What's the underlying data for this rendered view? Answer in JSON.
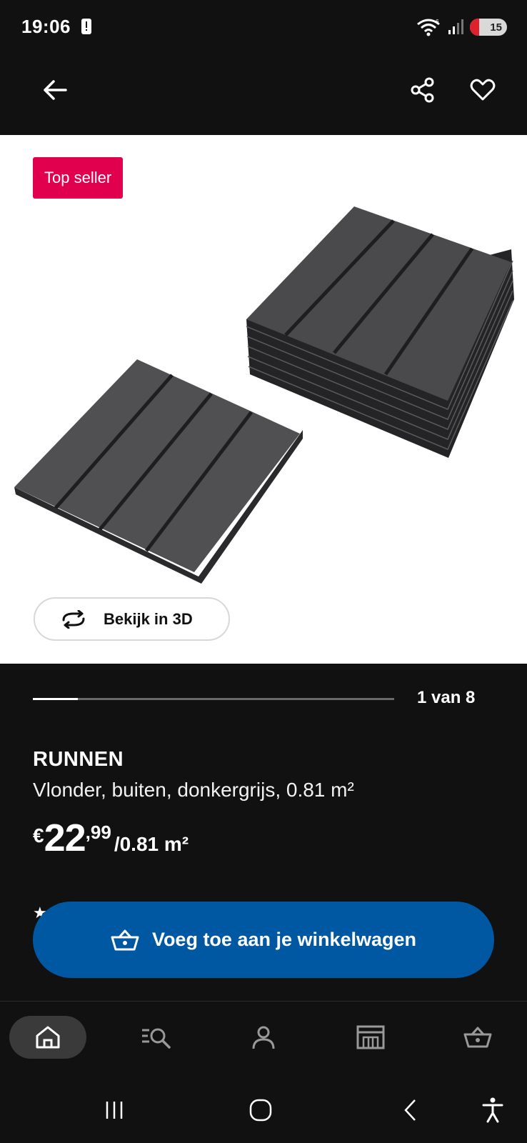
{
  "status_bar": {
    "time": "19:06",
    "battery_level": "15",
    "icons": [
      "alert-icon",
      "wifi-icon",
      "signal-icon",
      "battery-icon"
    ]
  },
  "header": {
    "back_icon": "arrow-left-icon",
    "share_icon": "share-icon",
    "favorite_icon": "heart-icon"
  },
  "gallery": {
    "badge": "Top seller",
    "view_3d_label": "Bekijk in 3D",
    "position_label": "1 van 8",
    "current_index": 1,
    "total_images": 8,
    "progress_fraction": 0.125
  },
  "product": {
    "name": "RUNNEN",
    "description": "Vlonder, buiten, donkergrijs, 0.81 m²",
    "price": {
      "currency": "€",
      "integer": "22",
      "decimals": ",99",
      "unit": "/0.81 m²"
    }
  },
  "actions": {
    "add_to_cart_label": "Voeg toe aan je winkelwagen"
  },
  "bottom_nav": {
    "items": [
      {
        "name": "home",
        "icon": "home-icon",
        "active": true
      },
      {
        "name": "search",
        "icon": "search-list-icon",
        "active": false
      },
      {
        "name": "profile",
        "icon": "user-icon",
        "active": false
      },
      {
        "name": "store",
        "icon": "store-icon",
        "active": false
      },
      {
        "name": "cart",
        "icon": "basket-icon",
        "active": false
      }
    ]
  },
  "colors": {
    "background": "#111111",
    "badge": "#e0004e",
    "primary_button": "#0058a3",
    "product_tile": "#4a4a4c"
  }
}
